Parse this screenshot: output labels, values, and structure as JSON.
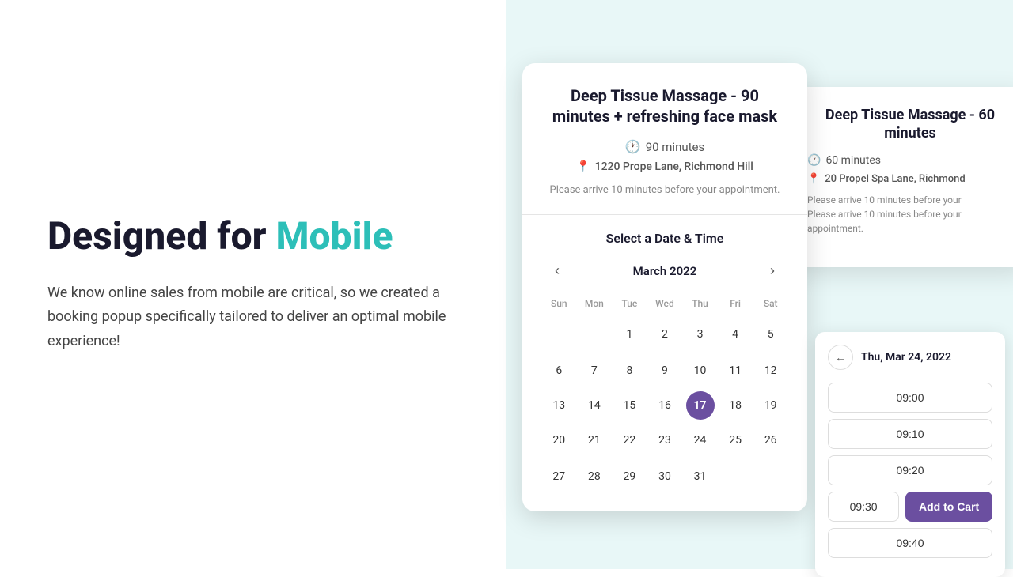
{
  "left": {
    "heading_normal": "Designed for ",
    "heading_highlight": "Mobile",
    "body_text": "We know online sales from mobile are critical, so we created a booking popup specifically tailored to deliver an optimal mobile experience!"
  },
  "main_card": {
    "title": "Deep Tissue Massage - 90 minutes + refreshing face mask",
    "duration": "90 minutes",
    "location": "1220 Prope Lane, Richmond Hill",
    "note": "Please arrive 10 minutes before your appointment.",
    "section_title": "Select a Date & Time",
    "calendar": {
      "month_label": "March 2022",
      "days_of_week": [
        "Sun",
        "Mon",
        "Tue",
        "Wed",
        "Thu",
        "Fri",
        "Sat"
      ],
      "weeks": [
        [
          "",
          "",
          "1",
          "2",
          "3",
          "4",
          "5"
        ],
        [
          "6",
          "7",
          "8",
          "9",
          "10",
          "11",
          "12"
        ],
        [
          "13",
          "14",
          "15",
          "16",
          "17",
          "18",
          "19"
        ],
        [
          "20",
          "21",
          "22",
          "23",
          "24",
          "25",
          "26"
        ],
        [
          "27",
          "28",
          "29",
          "30",
          "31",
          "",
          ""
        ]
      ],
      "selected_day": "17"
    }
  },
  "bg_card": {
    "title": "Deep Tissue Massage - 60 minutes",
    "duration": "60 minutes",
    "location": "20 Propel Spa Lane, Richmond",
    "note": "Please arrive 10 minutes before your appointment."
  },
  "datetime_panel": {
    "back_icon": "←",
    "selected_date": "Thu, Mar 24, 2022",
    "time_slots": [
      "09:00",
      "09:10",
      "09:20"
    ],
    "time_slot_partial": "09:30",
    "add_to_cart_label": "Add to Cart",
    "time_slot_last": "09:40"
  }
}
